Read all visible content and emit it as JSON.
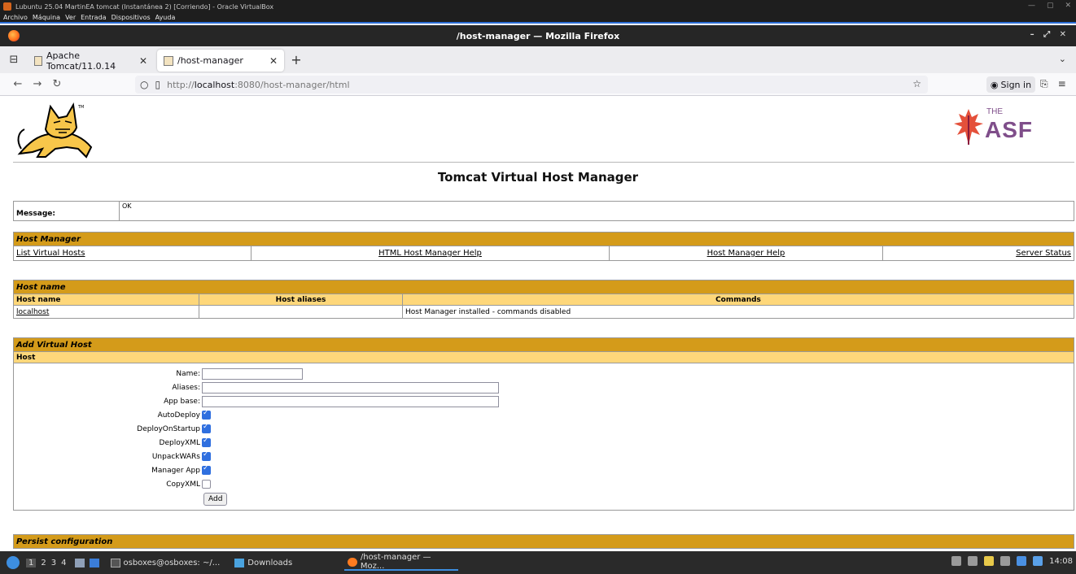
{
  "vbox": {
    "title": "Lubuntu 25.04 MartinEA tomcat (Instantánea 2) [Corriendo] - Oracle VirtualBox",
    "menu": [
      "Archivo",
      "Máquina",
      "Ver",
      "Entrada",
      "Dispositivos",
      "Ayuda"
    ]
  },
  "firefox": {
    "window_title": "/host-manager — Mozilla Firefox",
    "tabs": [
      {
        "label": "Apache Tomcat/11.0.14",
        "active": false
      },
      {
        "label": "/host-manager",
        "active": true
      }
    ],
    "url_prefix": "http://",
    "url_host": "localhost",
    "url_rest": ":8080/host-manager/html",
    "signin_label": "Sign in"
  },
  "page": {
    "title": "Tomcat Virtual Host Manager",
    "asf_the": "THE",
    "asf_name": "ASF",
    "message": {
      "label": "Message:",
      "value": "OK"
    },
    "host_manager": {
      "header": "Host Manager",
      "links": [
        "List Virtual Hosts",
        "HTML Host Manager Help",
        "Host Manager Help",
        "Server Status"
      ]
    },
    "host_name": {
      "header": "Host name",
      "columns": [
        "Host name",
        "Host aliases",
        "Commands"
      ],
      "rows": [
        {
          "host": "localhost",
          "aliases": "",
          "commands": "Host Manager installed - commands disabled"
        }
      ]
    },
    "add_virtual_host": {
      "header": "Add Virtual Host",
      "subheader": "Host",
      "fields": {
        "name": "Name:",
        "aliases": "Aliases:",
        "app_base": "App base:"
      },
      "checkboxes": [
        {
          "label": "AutoDeploy",
          "checked": true
        },
        {
          "label": "DeployOnStartup",
          "checked": true
        },
        {
          "label": "DeployXML",
          "checked": true
        },
        {
          "label": "UnpackWARs",
          "checked": true
        },
        {
          "label": "Manager App",
          "checked": true
        },
        {
          "label": "CopyXML",
          "checked": false
        }
      ],
      "add_button": "Add"
    },
    "persist": {
      "header": "Persist configuration"
    }
  },
  "taskbar": {
    "workspaces": [
      "1",
      "2",
      "3",
      "4"
    ],
    "items": [
      "osboxes@osboxes: ~/...",
      "Downloads",
      "/host-manager — Moz..."
    ],
    "clock": "14:08"
  }
}
